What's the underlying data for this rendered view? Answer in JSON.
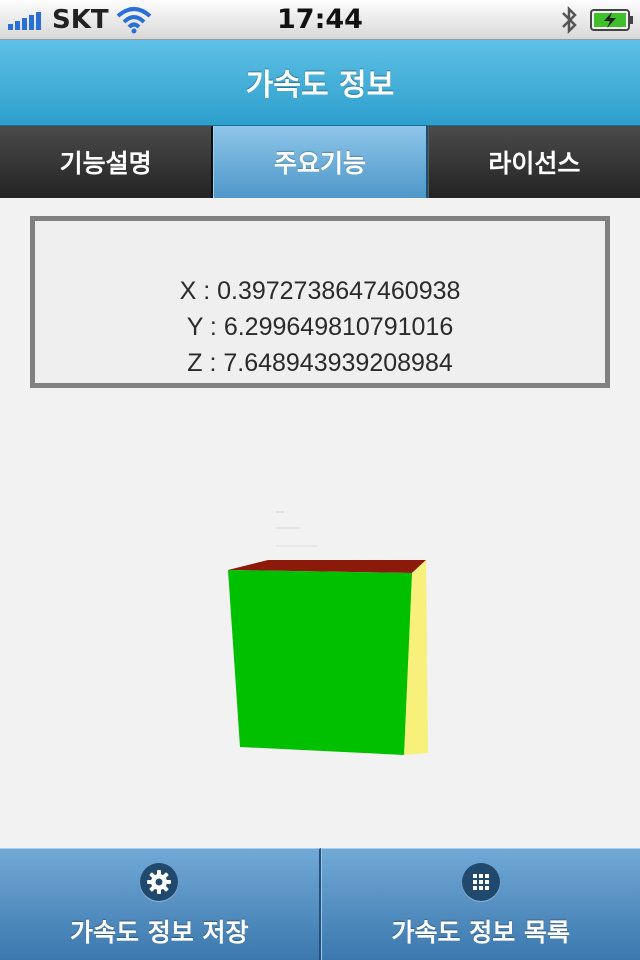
{
  "status_bar": {
    "carrier": "SKT",
    "time": "17:44",
    "signal_icon": "signal-bars-icon",
    "wifi_icon": "wifi-icon",
    "bluetooth_icon": "bluetooth-icon",
    "battery_icon": "battery-charging-icon"
  },
  "header": {
    "title": "가속도 정보"
  },
  "tabs": [
    {
      "label": "기능설명",
      "active": false
    },
    {
      "label": "주요기능",
      "active": true
    },
    {
      "label": "라이선스",
      "active": false
    }
  ],
  "accel": {
    "x_line": "X : 0.3972738647460938",
    "y_line": "Y : 6.299649810791016",
    "z_line": "Z : 7.648943939208984"
  },
  "cube": {
    "front_color": "#00c000",
    "top_color": "#8b1a0a",
    "side_color": "#f7f07a"
  },
  "toolbar": {
    "save_label": "가속도 정보 저장",
    "save_icon": "gear-icon",
    "list_label": "가속도 정보 목록",
    "list_icon": "grid-icon"
  },
  "colors": {
    "header_blue": "#3aa9d6",
    "active_tab": "#6aaedb",
    "toolbar_blue": "#5a93c4"
  }
}
